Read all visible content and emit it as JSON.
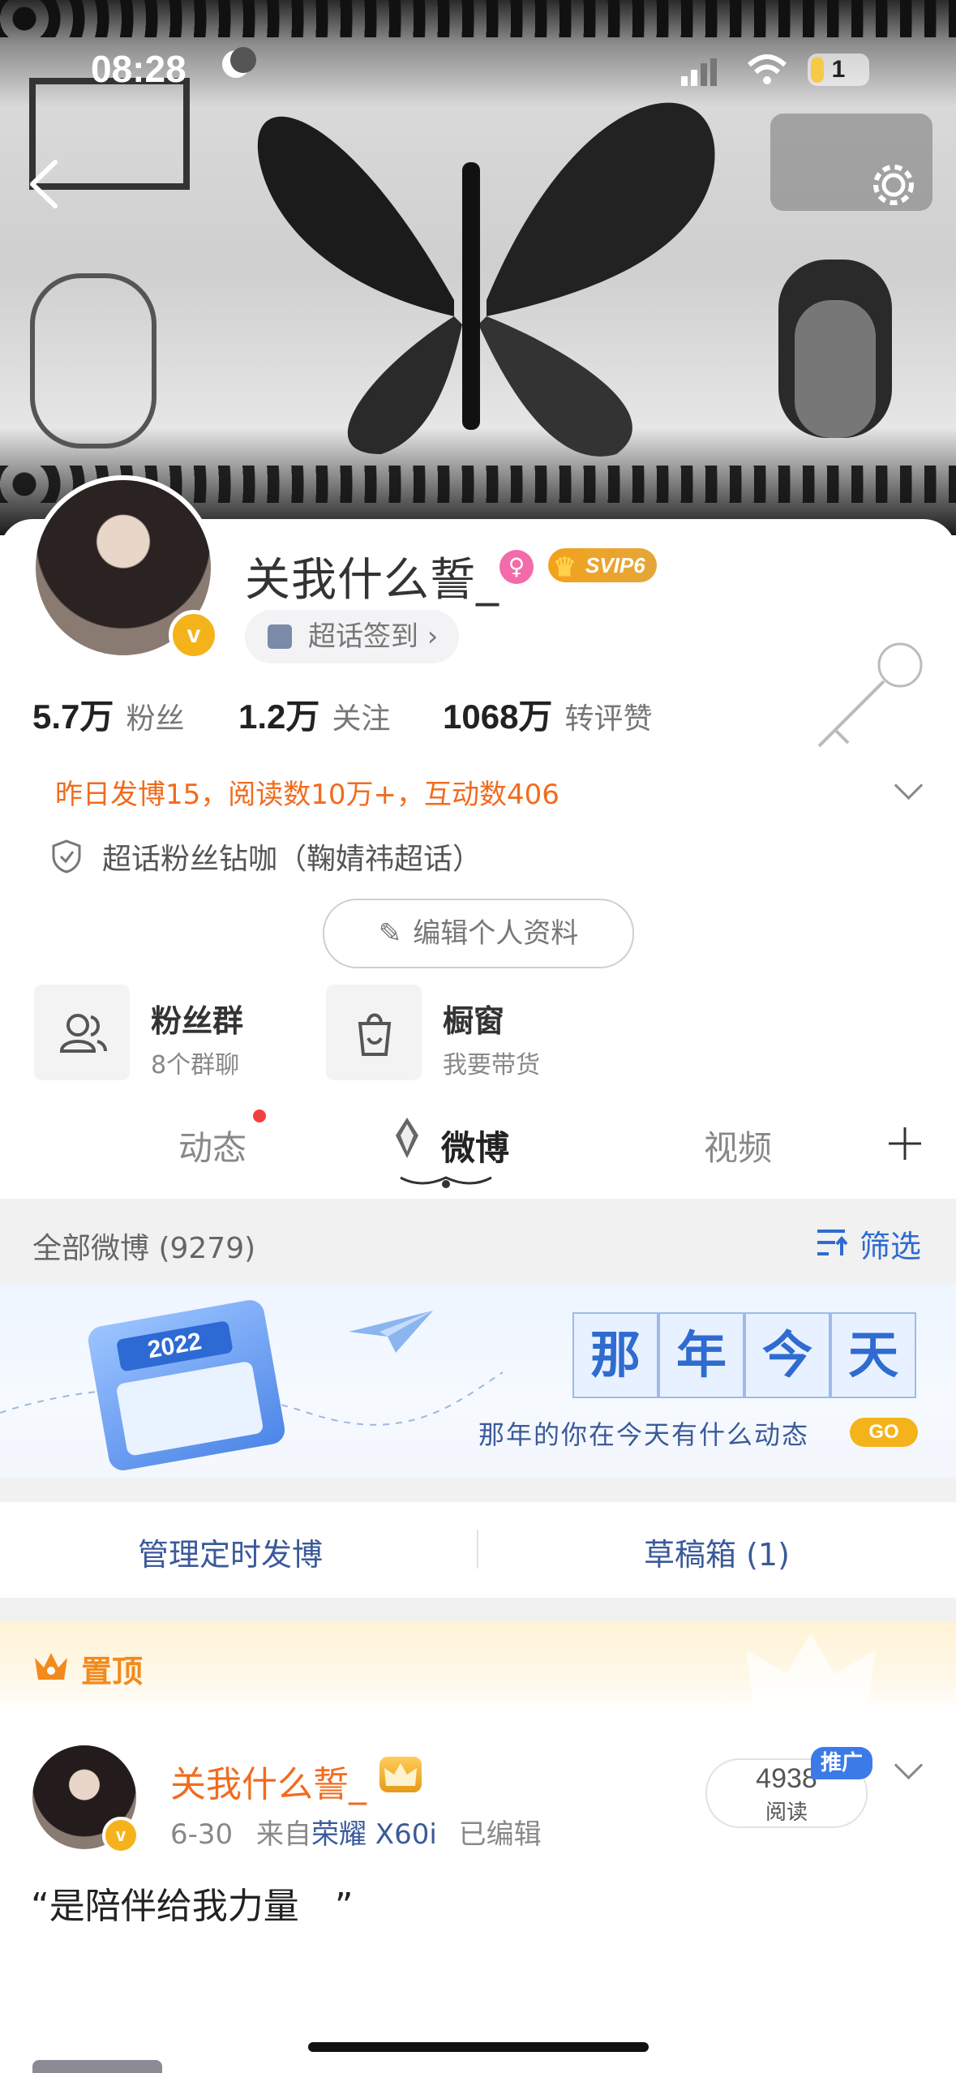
{
  "status_bar": {
    "time": "08:28",
    "battery": "1"
  },
  "profile": {
    "username": "关我什么誓_",
    "vip_label": "SVIP6",
    "verified_mark": "v",
    "checkin_label": "超话签到 ›",
    "stats": [
      {
        "value": "5.7万",
        "label": "粉丝"
      },
      {
        "value": "1.2万",
        "label": "关注"
      },
      {
        "value": "1068万",
        "label": "转评赞"
      }
    ],
    "activity_summary": "昨日发博15，阅读数10万+，互动数406",
    "supertopic_badge": "超话粉丝钻咖（鞠婧祎超话）",
    "edit_button": "编辑个人资料"
  },
  "tiles": [
    {
      "title": "粉丝群",
      "subtitle": "8个群聊",
      "icon": "people-icon"
    },
    {
      "title": "橱窗",
      "subtitle": "我要带货",
      "icon": "shopping-bag-icon"
    }
  ],
  "tabs": [
    {
      "label": "动态",
      "has_dot": true
    },
    {
      "label": "微博",
      "active": true
    },
    {
      "label": "视频"
    }
  ],
  "feed": {
    "filter_title": "全部微博 (9279)",
    "filter_button": "筛选",
    "promo": {
      "title_chars": [
        "那",
        "年",
        "今",
        "天"
      ],
      "calendar_text": "2022",
      "subtitle": "那年的你在今天有什么动态",
      "go_label": "GO"
    },
    "actions": [
      "管理定时发博",
      "草稿箱 (1)"
    ],
    "pinned_label": "置顶"
  },
  "post": {
    "author": "关我什么誓_",
    "date": "6-30",
    "source_prefix": "来自",
    "device": "荣耀 X60i",
    "edited": "已编辑",
    "read_count": "4938",
    "read_label": "阅读",
    "promo_badge": "推广",
    "text": "“是陪伴给我力量　”"
  },
  "colors": {
    "accent": "#f26b1d",
    "link_blue": "#3b5a9a",
    "gold": "#f5b31b"
  }
}
